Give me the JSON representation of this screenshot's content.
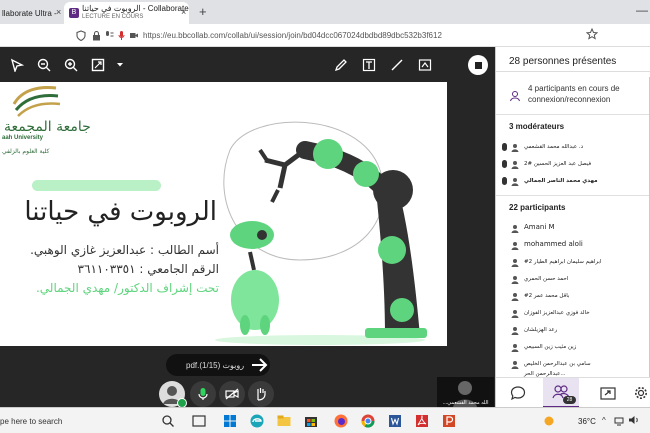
{
  "browser": {
    "tab1_title": "llaborate Ultra -",
    "tab2_title": "الروبوت في حياتنا - Collaborate",
    "tab2_subtitle": "LECTURE EN COURS",
    "tab2_favicon": "B",
    "close_glyph": "×",
    "new_tab_glyph": "+",
    "minimize_glyph": "—",
    "url": "https://eu.bbcollab.com/collab/ui/session/join/bd04dcc067024dbdbd89dbc532b3f612"
  },
  "slide": {
    "logo_ar": "جامعة المجمعة",
    "logo_en": "aah University",
    "logo_sub": "كلية العلوم بالزلفي",
    "title": "الروبوت في حياتنا",
    "student_line": "أسم الطالب : عبدالعزيز غازي الوهبي.",
    "id_line": "الرقم الجامعي : ٣٦١١٠٣٣٥١",
    "supervisor_line": "تحت إشراف الدكتور/ مهدي الجمالي."
  },
  "controls": {
    "pager_text": "pdf.روبوت (1/15)",
    "presenter_name": "...الله محمد القشعمي"
  },
  "panel": {
    "header": "28 personnes présentes",
    "connection_text": "4 participants en cours de connexion/reconnexion",
    "moderators_title": "3 modérateurs",
    "moderators": [
      "د. عبدالله محمد القشعمي",
      "فيصل عبد العزيز الحسين #2",
      "مهدي محمد الناصر الجمالي"
    ],
    "participants_title": "22 participants",
    "participants": [
      "Amani M",
      "mohammed aloli",
      "#2 ابراهيم سليمان ابراهيم الطيار",
      "احمد حسن الحمري",
      "#2 باقل محمد عمر",
      "خالد فوزي عبدالعزيز الفوزان",
      "رعد الهزيلشان",
      "زين مثيب زين السبيعي",
      "سامي بن عبدالرحمن الخليص",
      "عبدالرحمن الحر..."
    ],
    "people_count": "28"
  },
  "taskbar": {
    "search_text": "pe here to search",
    "temperature": "36°C",
    "tray_arrow": "^"
  },
  "colors": {
    "brand_purple": "#5e2a84",
    "slide_green": "#5fd47e",
    "logo_green": "#2f6e3a"
  }
}
